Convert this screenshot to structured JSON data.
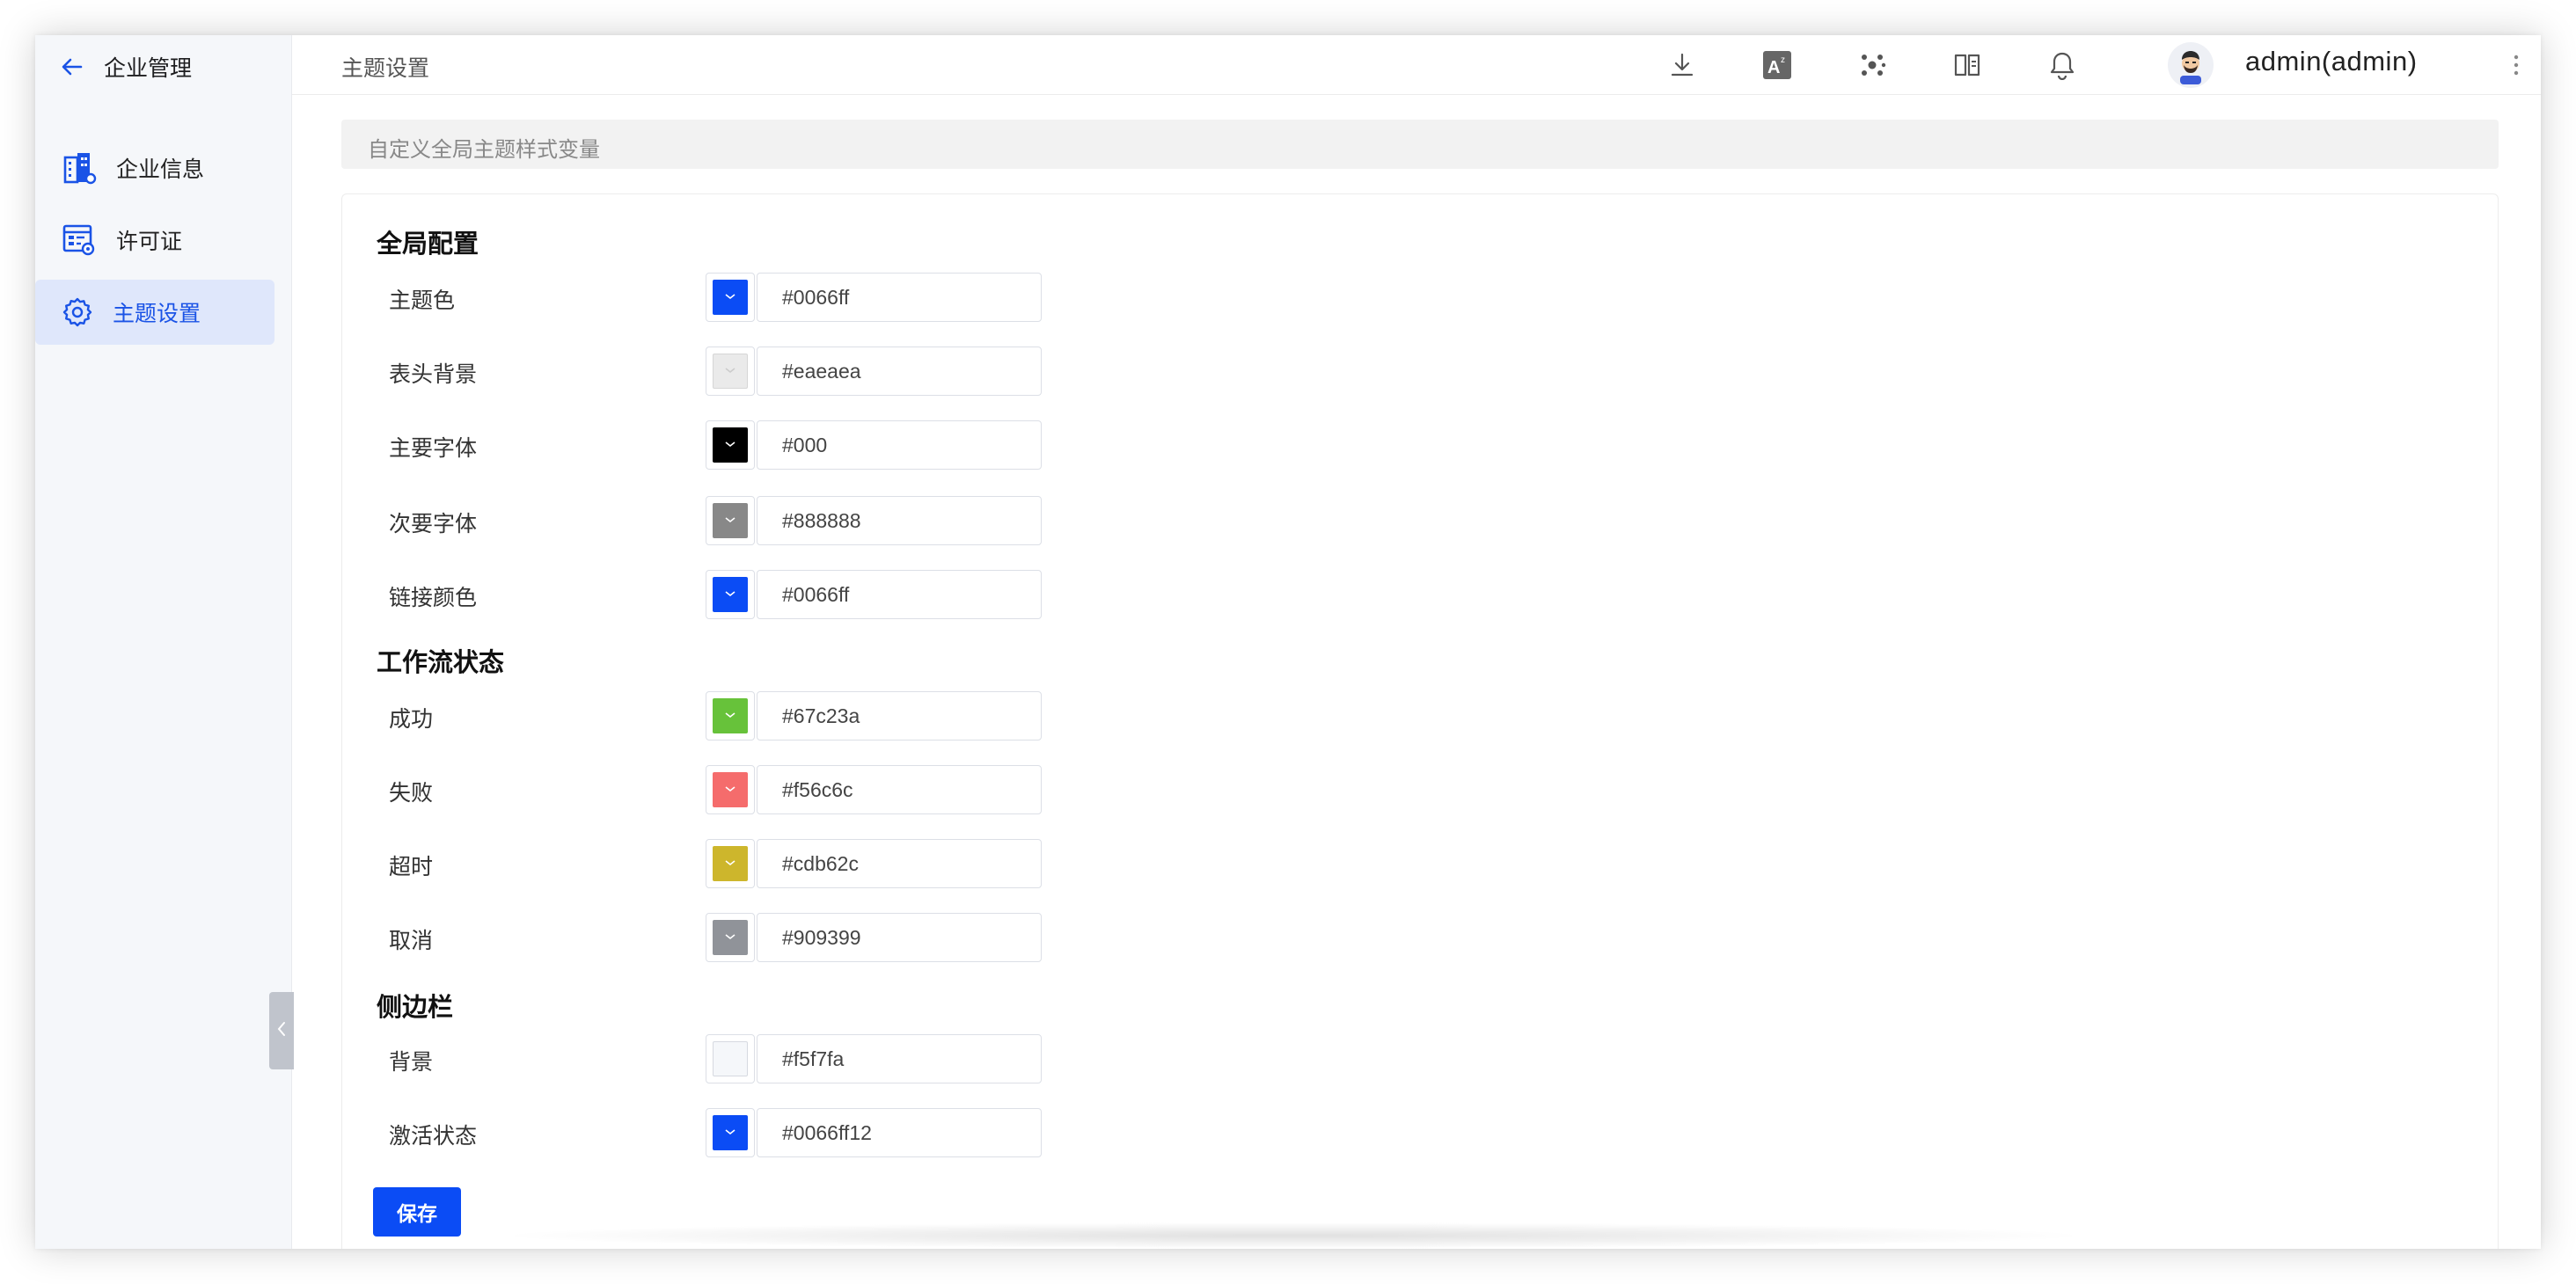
{
  "sidebar": {
    "title": "企业管理",
    "items": [
      {
        "label": "企业信息",
        "icon": "building-icon",
        "active": false
      },
      {
        "label": "许可证",
        "icon": "license-icon",
        "active": false
      },
      {
        "label": "主题设置",
        "icon": "gear-icon",
        "active": true
      }
    ]
  },
  "topbar": {
    "breadcrumb": "主题设置",
    "icons": [
      "download-icon",
      "translate-icon",
      "network-icon",
      "book-icon",
      "bell-icon"
    ],
    "username": "admin(admin)"
  },
  "description": "自定义全局主题样式变量",
  "sections": [
    {
      "title": "全局配置",
      "rows": [
        {
          "label": "主题色",
          "value": "#0066ff",
          "swatch": "#0b4cf5"
        },
        {
          "label": "表头背景",
          "value": "#eaeaea",
          "swatch": "#eaeaea"
        },
        {
          "label": "主要字体",
          "value": "#000",
          "swatch": "#000000"
        },
        {
          "label": "次要字体",
          "value": "#888888",
          "swatch": "#888888"
        },
        {
          "label": "链接颜色",
          "value": "#0066ff",
          "swatch": "#0b4cf5"
        }
      ]
    },
    {
      "title": "工作流状态",
      "rows": [
        {
          "label": "成功",
          "value": "#67c23a",
          "swatch": "#67c23a"
        },
        {
          "label": "失败",
          "value": "#f56c6c",
          "swatch": "#f56c6c"
        },
        {
          "label": "超时",
          "value": "#cdb62c",
          "swatch": "#cdb62c"
        },
        {
          "label": "取消",
          "value": "#909399",
          "swatch": "#909399"
        }
      ]
    },
    {
      "title": "侧边栏",
      "rows": [
        {
          "label": "背景",
          "value": "#f5f7fa",
          "swatch": "#f5f7fa"
        },
        {
          "label": "激活状态",
          "value": "#0066ff12",
          "swatch": "#0b4cf5"
        }
      ]
    }
  ],
  "save_label": "保存"
}
